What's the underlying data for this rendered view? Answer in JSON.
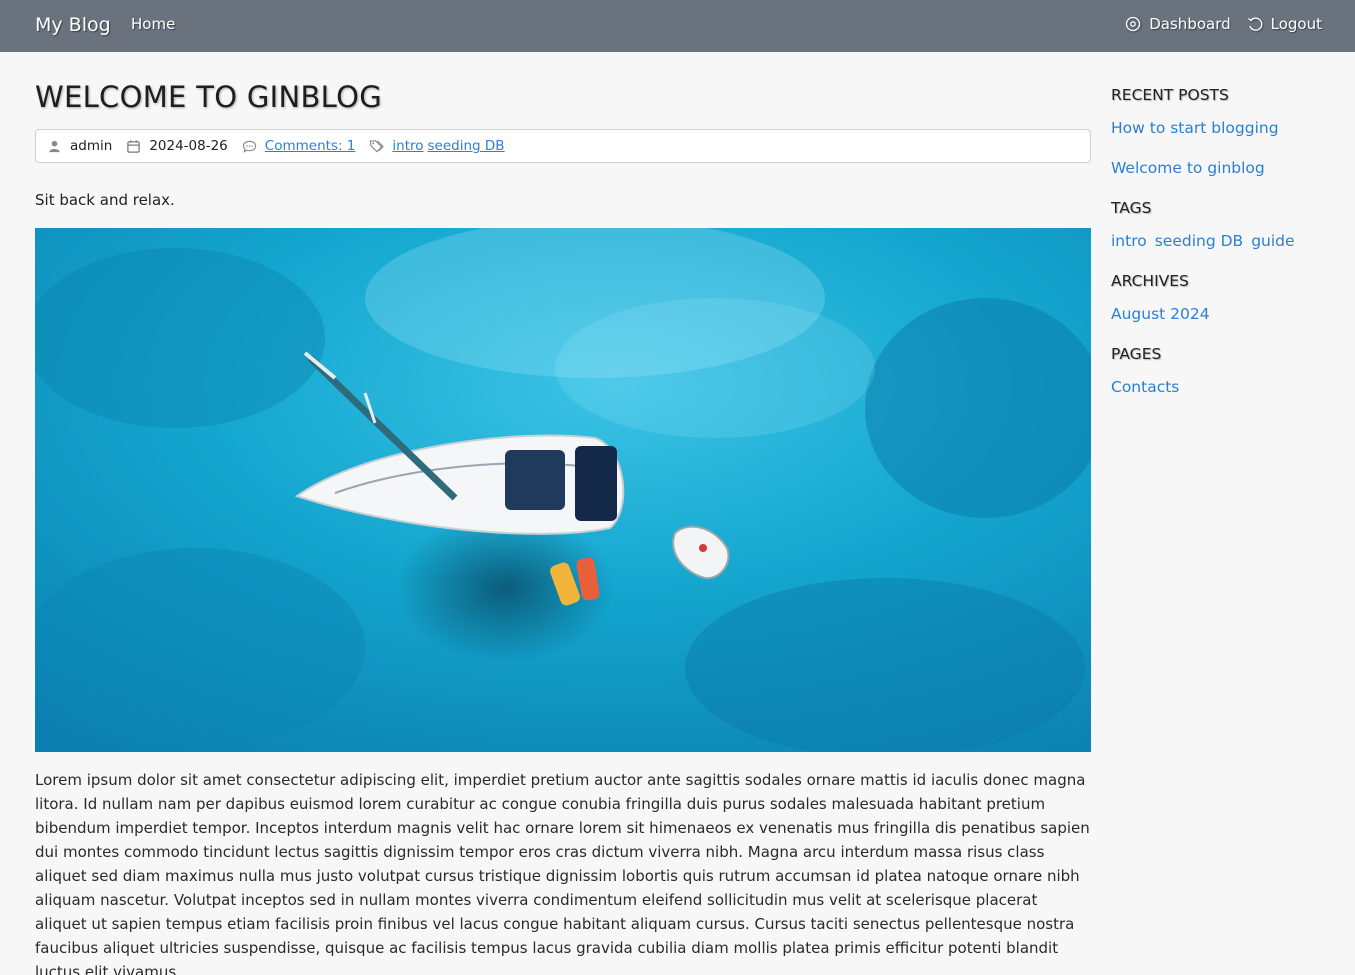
{
  "nav": {
    "brand": "My Blog",
    "home": "Home",
    "dashboard": "Dashboard",
    "logout": "Logout"
  },
  "post": {
    "title": "WELCOME TO GINBLOG",
    "author": "admin",
    "date": "2024-08-26",
    "comments": "Comments: 1",
    "tags": [
      "intro",
      "seeding DB"
    ],
    "lead": "Sit back and relax.",
    "body": "Lorem ipsum dolor sit amet consectetur adipiscing elit, imperdiet pretium auctor ante sagittis sodales ornare mattis id iaculis donec magna litora. Id nullam nam per dapibus euismod lorem curabitur ac congue conubia fringilla duis purus sodales malesuada habitant pretium bibendum imperdiet tempor. Inceptos interdum magnis velit hac ornare lorem sit himenaeos ex venenatis mus fringilla dis penatibus sapien dui montes commodo tincidunt lectus sagittis dignissim tempor eros cras dictum viverra nibh. Magna arcu interdum massa risus class aliquet sed diam maximus nulla mus justo volutpat cursus tristique dignissim lobortis quis rutrum accumsan id platea natoque ornare nibh aliquam nascetur. Volutpat inceptos sed in nullam montes viverra condimentum eleifend sollicitudin mus velit at scelerisque placerat aliquet ut sapien tempus etiam facilisis proin finibus vel lacus congue habitant aliquam cursus. Cursus taciti senectus pellentesque nostra faucibus aliquet ultricies suspendisse, quisque ac facilisis tempus lacus gravida cubilia diam mollis platea primis efficitur potenti blandit luctus elit vivamus."
  },
  "sidebar": {
    "recent_heading": "RECENT POSTS",
    "recent_posts": [
      "How to start blogging",
      "Welcome to ginblog"
    ],
    "tags_heading": "TAGS",
    "tags": [
      "intro",
      "seeding DB",
      "guide"
    ],
    "archives_heading": "ARCHIVES",
    "archives": [
      "August 2024"
    ],
    "pages_heading": "PAGES",
    "pages": [
      "Contacts"
    ]
  },
  "colors": {
    "navbar": "#6a727e",
    "link": "#2b7fd6",
    "background": "#f7f7f7",
    "sea": "#13a8cf"
  },
  "icons": {
    "dashboard": "palette-icon",
    "logout": "undo-arrow-icon",
    "author": "user-icon",
    "date": "calendar-icon",
    "comments": "comment-icon",
    "tags": "tags-icon"
  }
}
